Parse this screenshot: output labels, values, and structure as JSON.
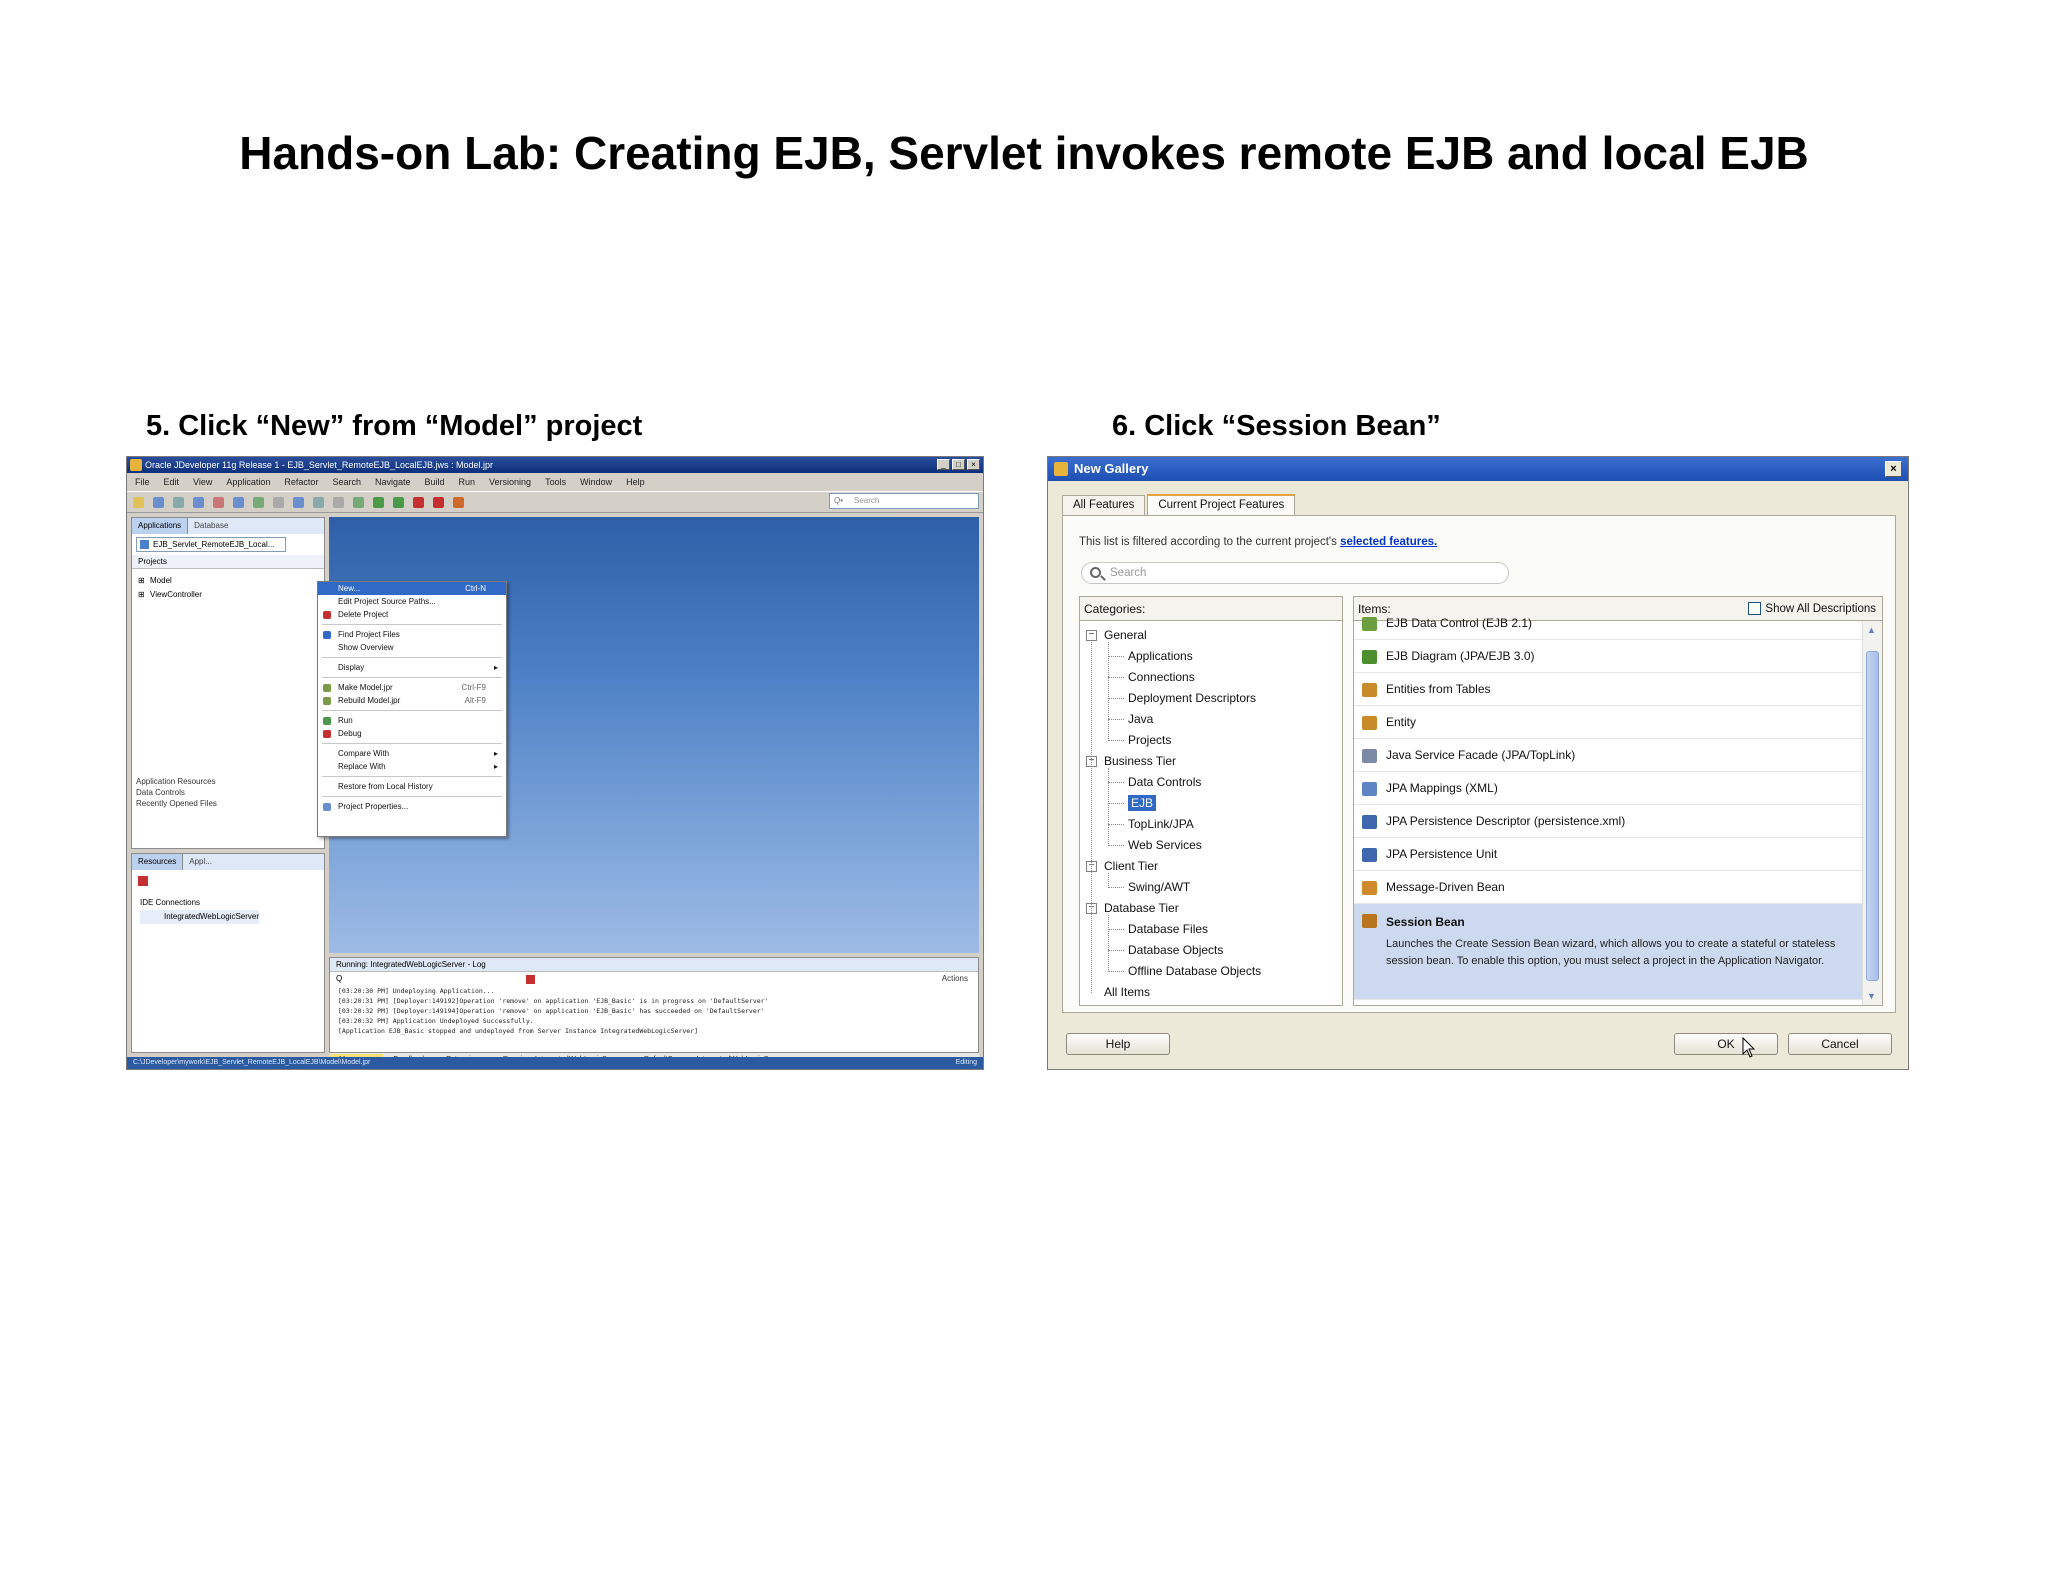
{
  "page_title": "Hands-on Lab: Creating EJB, Servlet invokes remote EJB and local EJB",
  "steps": [
    {
      "caption": "5. Click “New” from “Model” project"
    },
    {
      "caption": "6. Click “Session Bean”"
    }
  ],
  "jdev": {
    "title": "Oracle JDeveloper 11g Release 1 - EJB_Servlet_RemoteEJB_LocalEJB.jws : Model.jpr",
    "menu": [
      "File",
      "Edit",
      "View",
      "Application",
      "Refactor",
      "Search",
      "Navigate",
      "Build",
      "Run",
      "Versioning",
      "Tools",
      "Window",
      "Help"
    ],
    "search_placeholder": "Search",
    "left_tabs": [
      "Applications",
      "Database"
    ],
    "app_combo": "EJB_Servlet_RemoteEJB_Local...",
    "projects_label": "Projects",
    "tree": [
      "Model",
      "ViewController"
    ],
    "context_menu": [
      {
        "label": "New...",
        "shortcut": "Ctrl-N",
        "selected": true
      },
      {
        "label": "Edit Project Source Paths..."
      },
      {
        "label": "Delete Project"
      },
      {
        "sep": true
      },
      {
        "label": "Find Project Files"
      },
      {
        "label": "Show Overview"
      },
      {
        "sep": true
      },
      {
        "label": "Display",
        "submenu": true
      },
      {
        "sep": true
      },
      {
        "label": "Make Model.jpr",
        "shortcut": "Ctrl-F9"
      },
      {
        "label": "Rebuild Model.jpr",
        "shortcut": "Alt-F9"
      },
      {
        "sep": true
      },
      {
        "label": "Run"
      },
      {
        "label": "Debug"
      },
      {
        "sep": true
      },
      {
        "label": "Compare With",
        "submenu": true
      },
      {
        "label": "Replace With",
        "submenu": true
      },
      {
        "sep": true
      },
      {
        "label": "Restore from Local History"
      },
      {
        "sep": true
      },
      {
        "label": "Project Properties..."
      }
    ],
    "left_bottom_list": [
      "Application Resources",
      "Data Controls",
      "Recently Opened Files"
    ],
    "structure_tabs": [
      "Resources",
      "Appl..."
    ],
    "structure_tree": [
      "IDE Connections",
      "IntegratedWebLogicServer"
    ],
    "log_title": "Running: IntegratedWebLogicServer - Log",
    "log_actions": "Actions",
    "log_lines": [
      "[03:20:30 PM] Undeploying Application...",
      "[03:20:31 PM] [Deployer:149192]Operation 'remove' on application 'EJB_Basic' is in progress on 'DefaultServer'",
      "[03:20:32 PM] [Deployer:149194]Operation 'remove' on application 'EJB_Basic' has succeeded on 'DefaultServer'",
      "[03:20:32 PM] Application Undeployed Successfully.",
      "[Application EJB_Basic stopped and undeployed from Server Instance IntegratedWebLogicServer]"
    ],
    "bottom_tabs": [
      "Messages",
      "Feedback",
      "Extensions",
      "Running: IntegratedWebLogicServer",
      "DefaultServer - IntegratedWebLogicServer"
    ],
    "status_left": "C:\\JDeveloper\\mywork\\EJB_Servlet_RemoteEJB_LocalEJB\\Model\\Model.jpr",
    "status_right": "Editing"
  },
  "gallery": {
    "title": "New Gallery",
    "tabs": [
      "All Features",
      "Current Project Features"
    ],
    "active_tab": 1,
    "filter_text": "This list is filtered according to the current project's ",
    "filter_link": "selected features.",
    "search_placeholder": "Search",
    "categories_label": "Categories:",
    "items_label": "Items:",
    "show_all_label": "Show All Descriptions",
    "categories": [
      {
        "label": "General",
        "root": true
      },
      {
        "label": "Applications"
      },
      {
        "label": "Connections"
      },
      {
        "label": "Deployment Descriptors"
      },
      {
        "label": "Java"
      },
      {
        "label": "Projects"
      },
      {
        "label": "Business Tier",
        "root": true
      },
      {
        "label": "Data Controls"
      },
      {
        "label": "EJB",
        "selected": true
      },
      {
        "label": "TopLink/JPA"
      },
      {
        "label": "Web Services"
      },
      {
        "label": "Client Tier",
        "root": true
      },
      {
        "label": "Swing/AWT"
      },
      {
        "label": "Database Tier",
        "root": true
      },
      {
        "label": "Database Files"
      },
      {
        "label": "Database Objects"
      },
      {
        "label": "Offline Database Objects"
      },
      {
        "label": "All Items",
        "leaf_root": true
      }
    ],
    "items": [
      {
        "label": "EJB Data Control (EJB 2.1)",
        "icon": "#6b9e3c"
      },
      {
        "label": "EJB Diagram (JPA/EJB 3.0)",
        "icon": "#4d8f2e"
      },
      {
        "label": "Entities from Tables",
        "icon": "#c98a2a"
      },
      {
        "label": "Entity",
        "icon": "#c98a2a"
      },
      {
        "label": "Java Service Facade (JPA/TopLink)",
        "icon": "#7c8aa6"
      },
      {
        "label": "JPA Mappings (XML)",
        "icon": "#5f84c4"
      },
      {
        "label": "JPA Persistence Descriptor (persistence.xml)",
        "icon": "#3f67ad"
      },
      {
        "label": "JPA Persistence Unit",
        "icon": "#3f67ad"
      },
      {
        "label": "Message-Driven Bean",
        "icon": "#d08a2b"
      },
      {
        "label": "Session Bean",
        "icon": "#b8741f",
        "selected": true,
        "description": "Launches the Create Session Bean wizard, which allows you to create a stateful or stateless session bean. To enable this option, you must select a project in the Application Navigator."
      }
    ],
    "help_label": "Help",
    "ok_label": "OK",
    "cancel_label": "Cancel"
  }
}
